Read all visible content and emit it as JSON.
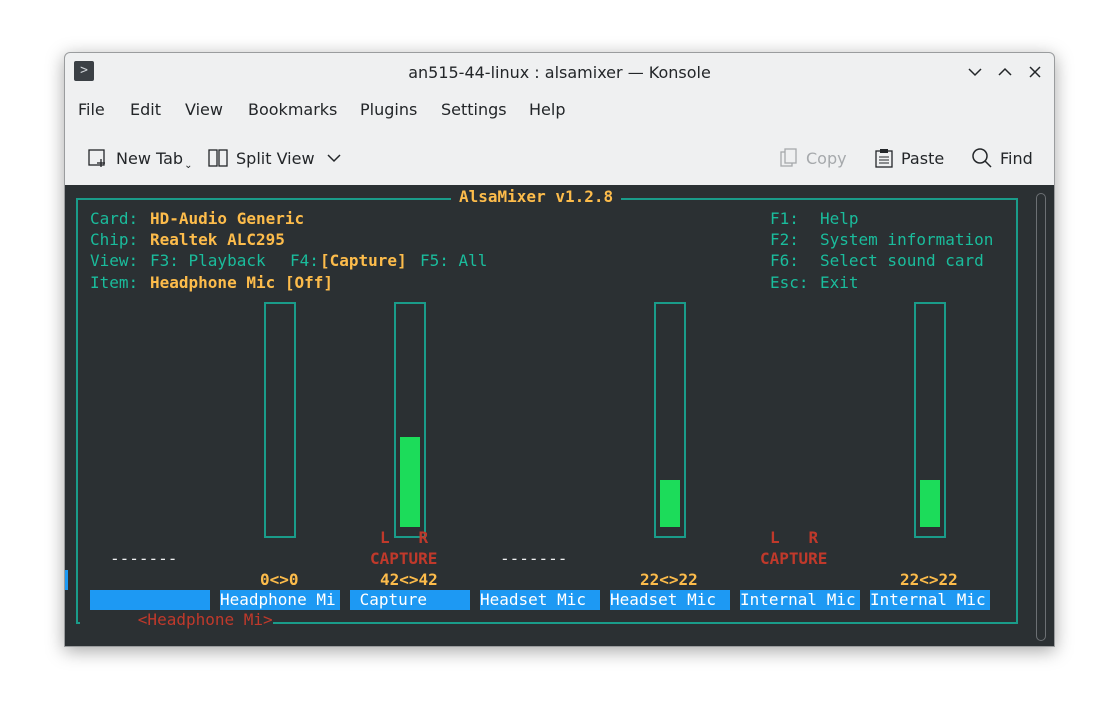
{
  "window": {
    "title": "an515-44-linux : alsamixer — Konsole",
    "app_icon": "terminal-icon"
  },
  "menubar": [
    "File",
    "Edit",
    "View",
    "Bookmarks",
    "Plugins",
    "Settings",
    "Help"
  ],
  "toolbar": {
    "new_tab": "New Tab",
    "split_view": "Split View",
    "copy": "Copy",
    "paste": "Paste",
    "find": "Find"
  },
  "mixer": {
    "title": "AlsaMixer v1.2.8",
    "card_label": "Card:",
    "card_value": "HD-Audio Generic",
    "chip_label": "Chip:",
    "chip_value": "Realtek ALC295",
    "view_label": "View:",
    "view_f3": "F3: Playback",
    "view_f4_key": "F4:",
    "view_f4_value": "[Capture]",
    "view_f5": "F5: All",
    "item_label": "Item:",
    "item_value": "Headphone Mic [Off]",
    "help": [
      {
        "key": "F1:",
        "text": "Help"
      },
      {
        "key": "F2:",
        "text": "System information"
      },
      {
        "key": "F6:",
        "text": "Select sound card"
      },
      {
        "key": "Esc:",
        "text": "Exit"
      }
    ],
    "channels": [
      {
        "label": "<Headphone Mi>",
        "dashes": "-------",
        "selected": true
      },
      {
        "label": "Headphone Mi",
        "level": 0,
        "value": "0<>0"
      },
      {
        "label": " Capture",
        "level": 42,
        "value": "42<>42",
        "lr": "L   R",
        "capture": "CAPTURE"
      },
      {
        "label": "Headset Mic",
        "dashes": "-------"
      },
      {
        "label": "Headset Mic",
        "level": 22,
        "value": "22<>22"
      },
      {
        "label": "Internal Mic",
        "lr": "L   R",
        "capture": "CAPTURE"
      },
      {
        "label": "Internal Mic",
        "level": 22,
        "value": "22<>22"
      }
    ],
    "colors": {
      "teal": "#1abc9c",
      "orange": "#fdbc4b",
      "red": "#c0392b",
      "green": "#1cdc5a",
      "label_bg": "#1d99f3"
    }
  }
}
